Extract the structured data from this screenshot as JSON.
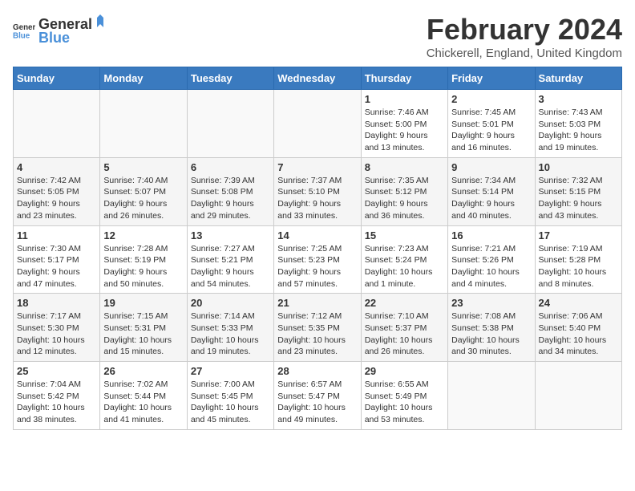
{
  "logo": {
    "general": "General",
    "blue": "Blue"
  },
  "header": {
    "title": "February 2024",
    "subtitle": "Chickerell, England, United Kingdom"
  },
  "calendar": {
    "days_of_week": [
      "Sunday",
      "Monday",
      "Tuesday",
      "Wednesday",
      "Thursday",
      "Friday",
      "Saturday"
    ],
    "weeks": [
      {
        "cells": [
          {
            "day": "",
            "info": ""
          },
          {
            "day": "",
            "info": ""
          },
          {
            "day": "",
            "info": ""
          },
          {
            "day": "",
            "info": ""
          },
          {
            "day": "1",
            "info": "Sunrise: 7:46 AM\nSunset: 5:00 PM\nDaylight: 9 hours\nand 13 minutes."
          },
          {
            "day": "2",
            "info": "Sunrise: 7:45 AM\nSunset: 5:01 PM\nDaylight: 9 hours\nand 16 minutes."
          },
          {
            "day": "3",
            "info": "Sunrise: 7:43 AM\nSunset: 5:03 PM\nDaylight: 9 hours\nand 19 minutes."
          }
        ]
      },
      {
        "cells": [
          {
            "day": "4",
            "info": "Sunrise: 7:42 AM\nSunset: 5:05 PM\nDaylight: 9 hours\nand 23 minutes."
          },
          {
            "day": "5",
            "info": "Sunrise: 7:40 AM\nSunset: 5:07 PM\nDaylight: 9 hours\nand 26 minutes."
          },
          {
            "day": "6",
            "info": "Sunrise: 7:39 AM\nSunset: 5:08 PM\nDaylight: 9 hours\nand 29 minutes."
          },
          {
            "day": "7",
            "info": "Sunrise: 7:37 AM\nSunset: 5:10 PM\nDaylight: 9 hours\nand 33 minutes."
          },
          {
            "day": "8",
            "info": "Sunrise: 7:35 AM\nSunset: 5:12 PM\nDaylight: 9 hours\nand 36 minutes."
          },
          {
            "day": "9",
            "info": "Sunrise: 7:34 AM\nSunset: 5:14 PM\nDaylight: 9 hours\nand 40 minutes."
          },
          {
            "day": "10",
            "info": "Sunrise: 7:32 AM\nSunset: 5:15 PM\nDaylight: 9 hours\nand 43 minutes."
          }
        ]
      },
      {
        "cells": [
          {
            "day": "11",
            "info": "Sunrise: 7:30 AM\nSunset: 5:17 PM\nDaylight: 9 hours\nand 47 minutes."
          },
          {
            "day": "12",
            "info": "Sunrise: 7:28 AM\nSunset: 5:19 PM\nDaylight: 9 hours\nand 50 minutes."
          },
          {
            "day": "13",
            "info": "Sunrise: 7:27 AM\nSunset: 5:21 PM\nDaylight: 9 hours\nand 54 minutes."
          },
          {
            "day": "14",
            "info": "Sunrise: 7:25 AM\nSunset: 5:23 PM\nDaylight: 9 hours\nand 57 minutes."
          },
          {
            "day": "15",
            "info": "Sunrise: 7:23 AM\nSunset: 5:24 PM\nDaylight: 10 hours\nand 1 minute."
          },
          {
            "day": "16",
            "info": "Sunrise: 7:21 AM\nSunset: 5:26 PM\nDaylight: 10 hours\nand 4 minutes."
          },
          {
            "day": "17",
            "info": "Sunrise: 7:19 AM\nSunset: 5:28 PM\nDaylight: 10 hours\nand 8 minutes."
          }
        ]
      },
      {
        "cells": [
          {
            "day": "18",
            "info": "Sunrise: 7:17 AM\nSunset: 5:30 PM\nDaylight: 10 hours\nand 12 minutes."
          },
          {
            "day": "19",
            "info": "Sunrise: 7:15 AM\nSunset: 5:31 PM\nDaylight: 10 hours\nand 15 minutes."
          },
          {
            "day": "20",
            "info": "Sunrise: 7:14 AM\nSunset: 5:33 PM\nDaylight: 10 hours\nand 19 minutes."
          },
          {
            "day": "21",
            "info": "Sunrise: 7:12 AM\nSunset: 5:35 PM\nDaylight: 10 hours\nand 23 minutes."
          },
          {
            "day": "22",
            "info": "Sunrise: 7:10 AM\nSunset: 5:37 PM\nDaylight: 10 hours\nand 26 minutes."
          },
          {
            "day": "23",
            "info": "Sunrise: 7:08 AM\nSunset: 5:38 PM\nDaylight: 10 hours\nand 30 minutes."
          },
          {
            "day": "24",
            "info": "Sunrise: 7:06 AM\nSunset: 5:40 PM\nDaylight: 10 hours\nand 34 minutes."
          }
        ]
      },
      {
        "cells": [
          {
            "day": "25",
            "info": "Sunrise: 7:04 AM\nSunset: 5:42 PM\nDaylight: 10 hours\nand 38 minutes."
          },
          {
            "day": "26",
            "info": "Sunrise: 7:02 AM\nSunset: 5:44 PM\nDaylight: 10 hours\nand 41 minutes."
          },
          {
            "day": "27",
            "info": "Sunrise: 7:00 AM\nSunset: 5:45 PM\nDaylight: 10 hours\nand 45 minutes."
          },
          {
            "day": "28",
            "info": "Sunrise: 6:57 AM\nSunset: 5:47 PM\nDaylight: 10 hours\nand 49 minutes."
          },
          {
            "day": "29",
            "info": "Sunrise: 6:55 AM\nSunset: 5:49 PM\nDaylight: 10 hours\nand 53 minutes."
          },
          {
            "day": "",
            "info": ""
          },
          {
            "day": "",
            "info": ""
          }
        ]
      }
    ]
  }
}
